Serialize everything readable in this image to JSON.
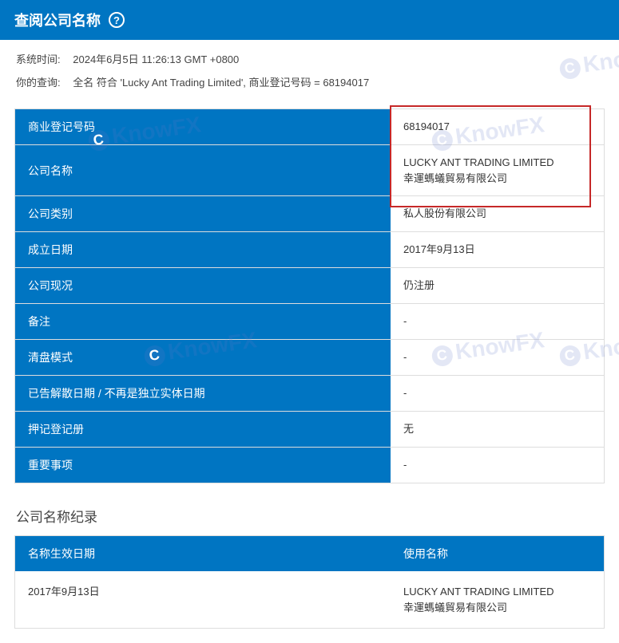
{
  "header": {
    "title": "查阅公司名称"
  },
  "meta": {
    "system_time_label": "系统时间:",
    "system_time_value": "2024年6月5日 11:26:13 GMT +0800",
    "query_label": "你的查询:",
    "query_value": "全名 符合 'Lucky Ant Trading Limited', 商业登记号码 = 68194017"
  },
  "details": [
    {
      "label": "商业登记号码",
      "value": "68194017"
    },
    {
      "label": "公司名称",
      "value": "LUCKY ANT TRADING LIMITED\n幸運螞蟻貿易有限公司"
    },
    {
      "label": "公司类别",
      "value": "私人股份有限公司"
    },
    {
      "label": "成立日期",
      "value": "2017年9月13日"
    },
    {
      "label": "公司现况",
      "value": "仍注册"
    },
    {
      "label": "备注",
      "value": "-"
    },
    {
      "label": "清盘模式",
      "value": "-"
    },
    {
      "label": "已告解散日期 / 不再是独立实体日期",
      "value": "-"
    },
    {
      "label": "押记登记册",
      "value": "无"
    },
    {
      "label": "重要事项",
      "value": "-"
    }
  ],
  "history": {
    "section_title": "公司名称纪录",
    "header_date": "名称生效日期",
    "header_name": "使用名称",
    "rows": [
      {
        "date": "2017年9月13日",
        "name": "LUCKY ANT TRADING LIMITED\n幸運螞蟻貿易有限公司"
      }
    ]
  },
  "watermark_text": "KnowFX"
}
